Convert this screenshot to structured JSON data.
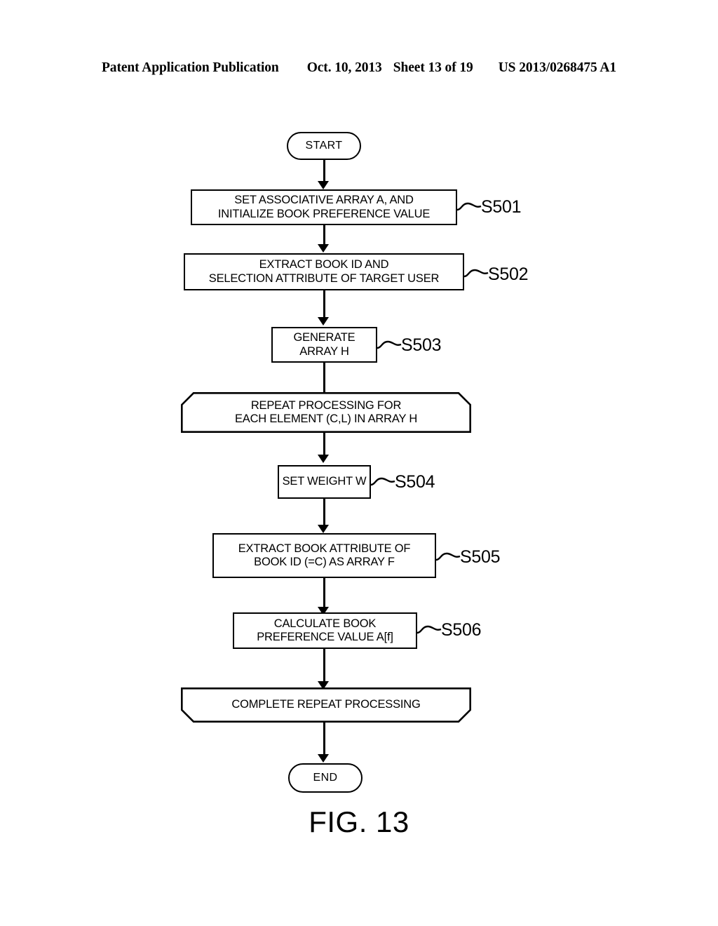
{
  "header": {
    "publication": "Patent Application Publication",
    "date": "Oct. 10, 2013",
    "sheet": "Sheet 13 of 19",
    "doc_number": "US 2013/0268475 A1"
  },
  "figure": {
    "caption": "FIG. 13",
    "nodes": [
      {
        "id": "start",
        "kind": "terminal",
        "text": "START"
      },
      {
        "id": "s501",
        "kind": "process",
        "text_line1": "SET ASSOCIATIVE ARRAY A, AND",
        "text_line2": "INITIALIZE BOOK PREFERENCE VALUE",
        "ref": "S501"
      },
      {
        "id": "s502",
        "kind": "process",
        "text_line1": "EXTRACT BOOK ID AND",
        "text_line2": "SELECTION ATTRIBUTE OF TARGET USER",
        "ref": "S502"
      },
      {
        "id": "s503",
        "kind": "process",
        "text_line1": "GENERATE",
        "text_line2": "ARRAY H",
        "ref": "S503"
      },
      {
        "id": "loop_start",
        "kind": "loop-start",
        "text_line1": "REPEAT PROCESSING FOR",
        "text_line2": "EACH ELEMENT (C,L) IN ARRAY H"
      },
      {
        "id": "s504",
        "kind": "process",
        "text_line1": "SET WEIGHT W",
        "ref": "S504"
      },
      {
        "id": "s505",
        "kind": "process",
        "text_line1": "EXTRACT BOOK ATTRIBUTE OF",
        "text_line2": "BOOK ID (=C) AS ARRAY F",
        "ref": "S505"
      },
      {
        "id": "s506",
        "kind": "process",
        "text_line1": "CALCULATE BOOK",
        "text_line2": "PREFERENCE VALUE A[f]",
        "ref": "S506"
      },
      {
        "id": "loop_end",
        "kind": "loop-end",
        "text_line1": "COMPLETE REPEAT PROCESSING"
      },
      {
        "id": "end",
        "kind": "terminal",
        "text": "END"
      }
    ]
  },
  "colors": {
    "ink": "#000000",
    "paper": "#ffffff"
  }
}
